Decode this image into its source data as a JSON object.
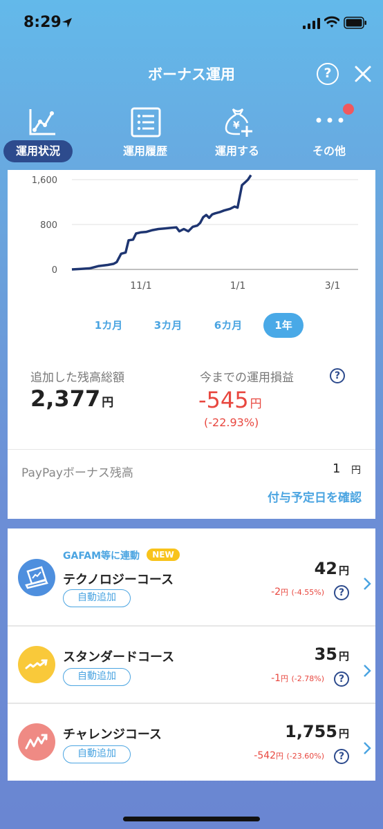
{
  "status_bar": {
    "time": "8:29"
  },
  "header": {
    "title": "ボーナス運用",
    "help": "?"
  },
  "nav": {
    "tabs": [
      {
        "label": "運用状況",
        "active": true
      },
      {
        "label": "運用履歴",
        "active": false
      },
      {
        "label": "運用する",
        "active": false
      },
      {
        "label": "その他",
        "active": false
      }
    ]
  },
  "chart_data": {
    "type": "line",
    "y_ticks": [
      "1,600",
      "800",
      "0"
    ],
    "x_ticks": [
      "11/1",
      "1/1",
      "3/1"
    ],
    "ylim": [
      0,
      1600
    ],
    "grid": true,
    "series": [
      {
        "color": "#1e3571",
        "points": [
          [
            0,
            0
          ],
          [
            6,
            10
          ],
          [
            12,
            20
          ],
          [
            18,
            60
          ],
          [
            24,
            80
          ],
          [
            28,
            100
          ],
          [
            30,
            130
          ],
          [
            33,
            280
          ],
          [
            36,
            300
          ],
          [
            38,
            520
          ],
          [
            41,
            530
          ],
          [
            43,
            640
          ],
          [
            46,
            660
          ],
          [
            50,
            670
          ],
          [
            54,
            700
          ],
          [
            58,
            720
          ],
          [
            62,
            730
          ],
          [
            66,
            740
          ],
          [
            70,
            750
          ],
          [
            72,
            680
          ],
          [
            75,
            720
          ],
          [
            78,
            680
          ],
          [
            81,
            760
          ],
          [
            84,
            780
          ],
          [
            86,
            830
          ],
          [
            88,
            930
          ],
          [
            90,
            970
          ],
          [
            92,
            920
          ],
          [
            94,
            980
          ],
          [
            96,
            1000
          ],
          [
            99,
            1020
          ],
          [
            102,
            1050
          ],
          [
            106,
            1080
          ],
          [
            109,
            1120
          ],
          [
            111,
            1100
          ],
          [
            114,
            1500
          ],
          [
            116,
            1550
          ],
          [
            118,
            1600
          ],
          [
            120,
            1680
          ]
        ]
      }
    ]
  },
  "ranges": [
    "1カ月",
    "3カ月",
    "6カ月",
    "1年"
  ],
  "active_range": "1年",
  "stats": {
    "added_label": "追加した残高総額",
    "added_value": "2,377",
    "unit": "円",
    "profit_label": "今までの運用損益",
    "profit_value": "-545",
    "profit_pct": "(-22.93%)",
    "help": "?"
  },
  "bonus": {
    "label": "PayPayボーナス残高",
    "amount": "1",
    "unit": "円",
    "confirm_link": "付与予定日を確認"
  },
  "courses": [
    {
      "tag": "GAFAM等に連動",
      "badge": "NEW",
      "name": "テクノロジーコース",
      "auto": "自動追加",
      "value": "42",
      "unit": "円",
      "change": "-2",
      "change_unit": "円",
      "change_pct": "(-4.55%)",
      "help": "?",
      "icon_color": "#4e8fde"
    },
    {
      "name": "スタンダードコース",
      "auto": "自動追加",
      "value": "35",
      "unit": "円",
      "change": "-1",
      "change_unit": "円",
      "change_pct": "(-2.78%)",
      "help": "?",
      "icon_color": "#f9c93a"
    },
    {
      "name": "チャレンジコース",
      "auto": "自動追加",
      "value": "1,755",
      "unit": "円",
      "change": "-542",
      "change_unit": "円",
      "change_pct": "(-23.60%)",
      "help": "?",
      "icon_color": "#ef8a84"
    }
  ]
}
